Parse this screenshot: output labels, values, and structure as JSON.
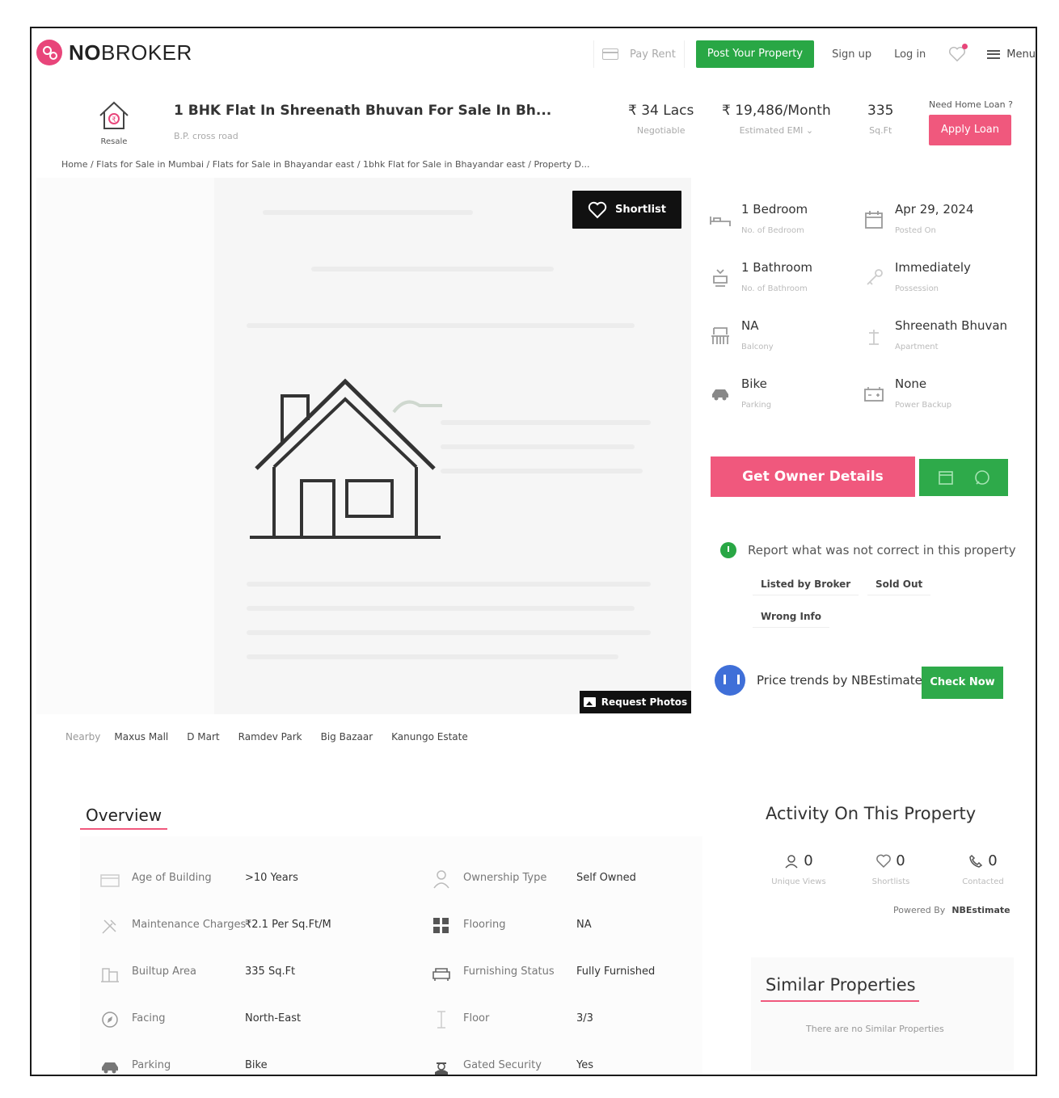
{
  "header": {
    "logo_bold": "NO",
    "logo_rest": "BROKER",
    "pay_rent": "Pay Rent",
    "post_property": "Post Your Property",
    "sign_up": "Sign up",
    "log_in": "Log in",
    "menu": "Menu"
  },
  "property": {
    "badge": "Resale",
    "title": "1 BHK Flat In Shreenath Bhuvan For Sale In Bh...",
    "address": "B.P. cross road",
    "price": "₹ 34 Lacs",
    "price_note": "Negotiable",
    "emi": "₹ 19,486/Month",
    "emi_note": "Estimated EMI",
    "area": "335",
    "area_unit": "Sq.Ft",
    "loan_question": "Need Home Loan ?",
    "apply_loan": "Apply Loan"
  },
  "breadcrumb": "Home / Flats for Sale in Mumbai / Flats for Sale in Bhayandar east / 1bhk Flat for Sale in Bhayandar east / Property D...",
  "gallery": {
    "shortlist": "Shortlist",
    "request_photos": "Request Photos"
  },
  "nearby": {
    "label": "Nearby",
    "places": [
      "Maxus Mall",
      "D Mart",
      "Ramdev Park",
      "Big Bazaar",
      "Kanungo Estate"
    ]
  },
  "details": [
    {
      "value": "1 Bedroom",
      "label": "No. of Bedroom",
      "icon": "bed-icon"
    },
    {
      "value": "Apr 29, 2024",
      "label": "Posted On",
      "icon": "calendar-icon"
    },
    {
      "value": "1 Bathroom",
      "label": "No. of Bathroom",
      "icon": "bathtub-icon"
    },
    {
      "value": "Immediately",
      "label": "Possession",
      "icon": "key-icon"
    },
    {
      "value": "NA",
      "label": "Balcony",
      "icon": "balcony-icon"
    },
    {
      "value": "Shreenath Bhuvan",
      "label": "Apartment",
      "icon": "apartment-icon"
    },
    {
      "value": "Bike",
      "label": "Parking",
      "icon": "car-icon"
    },
    {
      "value": "None",
      "label": "Power Backup",
      "icon": "battery-icon"
    }
  ],
  "actions": {
    "get_owner": "Get Owner Details"
  },
  "report": {
    "text": "Report what was not correct in this property",
    "chips": [
      "Listed by Broker",
      "Sold Out",
      "Wrong Info"
    ]
  },
  "trend": {
    "text": "Price trends by NBEstimate",
    "check_now": "Check Now"
  },
  "overview": {
    "title": "Overview",
    "rows": [
      {
        "key": "Age of Building",
        "value": ">10 Years",
        "icon": "building-age-icon"
      },
      {
        "key": "Ownership Type",
        "value": "Self Owned",
        "icon": "owner-icon"
      },
      {
        "key": "Maintenance Charges",
        "value": "₹2.1 Per Sq.Ft/M",
        "icon": "tools-icon"
      },
      {
        "key": "Flooring",
        "value": "NA",
        "icon": "flooring-icon"
      },
      {
        "key": "Builtup Area",
        "value": "335 Sq.Ft",
        "icon": "area-icon"
      },
      {
        "key": "Furnishing Status",
        "value": "Fully Furnished",
        "icon": "sofa-icon"
      },
      {
        "key": "Facing",
        "value": "North-East",
        "icon": "compass-icon"
      },
      {
        "key": "Floor",
        "value": "3/3",
        "icon": "floor-icon"
      },
      {
        "key": "Parking",
        "value": "Bike",
        "icon": "car-icon"
      },
      {
        "key": "Gated Security",
        "value": "Yes",
        "icon": "guard-icon"
      }
    ]
  },
  "activity": {
    "title": "Activity On This Property",
    "items": [
      {
        "count": "0",
        "label": "Unique Views",
        "icon": "user-icon"
      },
      {
        "count": "0",
        "label": "Shortlists",
        "icon": "heart-icon"
      },
      {
        "count": "0",
        "label": "Contacted",
        "icon": "phone-icon"
      }
    ],
    "powered_by": "Powered By",
    "powered_name": "NBEstimate"
  },
  "similar": {
    "title": "Similar Properties",
    "empty": "There are no Similar Properties"
  },
  "colors": {
    "brand_pink": "#f0587d",
    "brand_green": "#29a745"
  }
}
